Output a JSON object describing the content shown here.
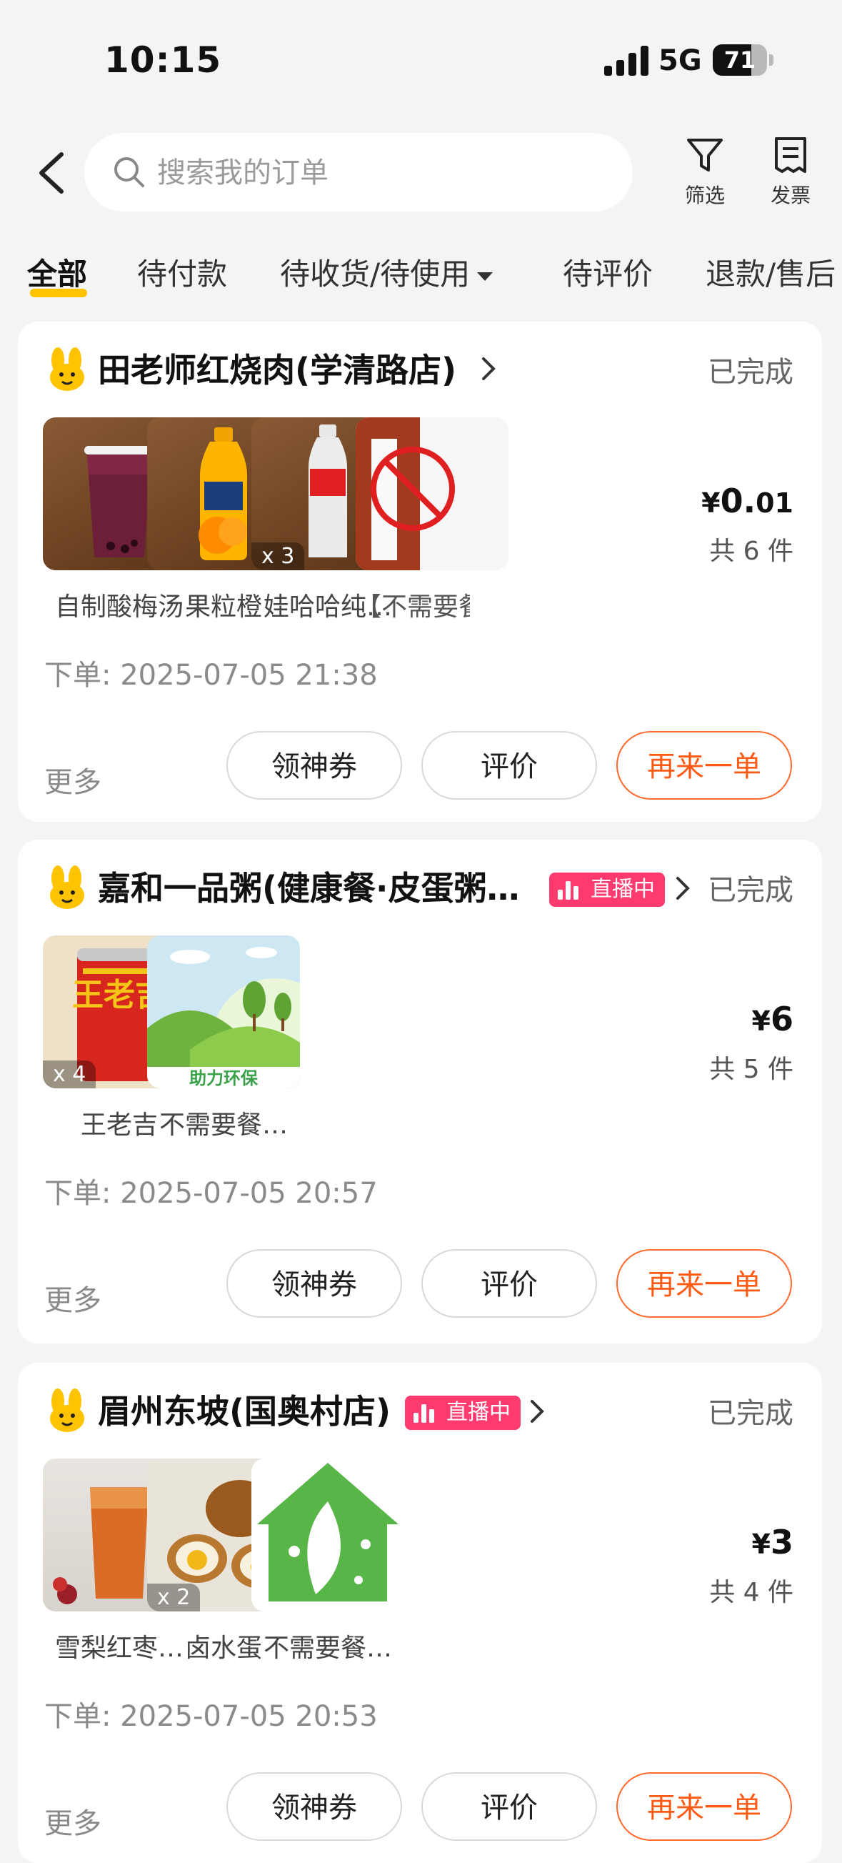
{
  "status_bar": {
    "time": "10:15",
    "network": "5G",
    "battery": "71",
    "battery_level": 0.71
  },
  "header": {
    "search_placeholder": "搜索我的订单",
    "filter_label": "筛选",
    "invoice_label": "发票"
  },
  "tabs": [
    {
      "label": "全部",
      "active": true
    },
    {
      "label": "待付款"
    },
    {
      "label": "待收货/待使用"
    },
    {
      "label": "待评价"
    },
    {
      "label": "退款/售后"
    }
  ],
  "orders": [
    {
      "shop": "田老师红烧肉(学清路店)",
      "live_badge": "",
      "status": "已完成",
      "price_symbol": "¥",
      "price_main": "0.",
      "price_decimal": "01",
      "count": "共 6 件",
      "items": [
        {
          "name": "自制酸梅汤",
          "qty": ""
        },
        {
          "name": "果粒橙",
          "qty": ""
        },
        {
          "name": "娃哈哈纯…",
          "qty": "x 3"
        },
        {
          "name": "【不需要餐",
          "qty": ""
        }
      ],
      "order_time": "下单: 2025-07-05 21:38",
      "more": "更多",
      "btn_coupon": "领神券",
      "btn_review": "评价",
      "btn_reorder": "再来一单"
    },
    {
      "shop": "嘉和一品粥(健康餐·皮蛋粥…",
      "live_badge": "直播中",
      "status": "已完成",
      "price_symbol": "¥",
      "price_main": "6",
      "count": "共 5 件",
      "items": [
        {
          "name": "王老吉",
          "qty": "x 4",
          "img_text": "王老吉"
        },
        {
          "name": "不需要餐…",
          "qty": "",
          "img_text": "助力环保"
        }
      ],
      "order_time": "下单: 2025-07-05 20:57",
      "more": "更多",
      "btn_coupon": "领神券",
      "btn_review": "评价",
      "btn_reorder": "再来一单"
    },
    {
      "shop": "眉州东坡(国奥村店)",
      "live_badge": "直播中",
      "status": "已完成",
      "price_symbol": "¥",
      "price_main": "3",
      "count": "共 4 件",
      "items": [
        {
          "name": "雪梨红枣…",
          "qty": ""
        },
        {
          "name": "卤水蛋",
          "qty": "x 2"
        },
        {
          "name": "不需要餐…",
          "qty": ""
        }
      ],
      "order_time": "下单: 2025-07-05 20:53",
      "more": "更多",
      "btn_coupon": "领神券",
      "btn_review": "评价",
      "btn_reorder": "再来一单"
    }
  ],
  "colors": {
    "accent_yellow": "#ffc300",
    "reorder_orange": "#ff5a14",
    "live_pink": "#ff3a6e",
    "background": "#f3f4f6"
  }
}
